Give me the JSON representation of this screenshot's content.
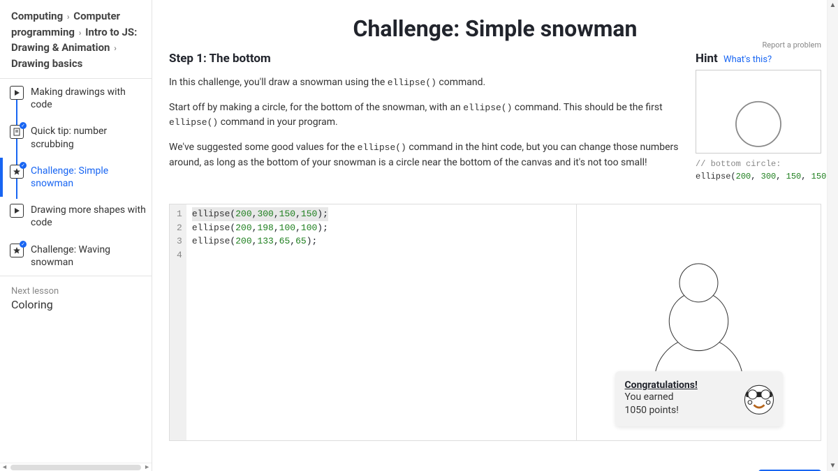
{
  "breadcrumb": [
    "Computing",
    "Computer programming",
    "Intro to JS: Drawing & Animation",
    "Drawing basics"
  ],
  "lessons": [
    {
      "label": "Making drawings with code",
      "icon": "play",
      "badge": false
    },
    {
      "label": "Quick tip: number scrubbing",
      "icon": "doc",
      "badge": true
    },
    {
      "label": "Challenge: Simple snowman",
      "icon": "star",
      "badge": true,
      "current": true
    },
    {
      "label": "Drawing more shapes with code",
      "icon": "play",
      "badge": false
    },
    {
      "label": "Challenge: Waving snowman",
      "icon": "star",
      "badge": true
    }
  ],
  "next_lesson": {
    "label": "Next lesson",
    "title": "Coloring"
  },
  "title": "Challenge: Simple snowman",
  "report_link": "Report a problem",
  "step_heading": "Step 1: The bottom",
  "instructions": {
    "p1_a": "In this challenge, you'll draw a snowman using the ",
    "p1_code": "ellipse()",
    "p1_b": " command.",
    "p2_a": "Start off by making a circle, for the bottom of the snowman, with an ",
    "p2_code": "ellipse()",
    "p2_b": " command. This should be the first ",
    "p2_code2": "ellipse()",
    "p2_c": " command in your program.",
    "p3_a": "We've suggested some good values for the ",
    "p3_code": "ellipse()",
    "p3_b": " command in the hint code, but you can change those numbers around, as long as the bottom of your snowman is a circle near the bottom of the canvas and it's not too small!"
  },
  "hint": {
    "label": "Hint",
    "whats_this": "What's this?",
    "code_comment": "// bottom circle:",
    "code_fn": "ellipse",
    "code_args": [
      "200",
      "300",
      "150",
      "150"
    ]
  },
  "editor": {
    "lines": [
      {
        "n": "1",
        "fn": "ellipse",
        "args": [
          "200",
          "300",
          "150",
          "150"
        ]
      },
      {
        "n": "2",
        "fn": "ellipse",
        "args": [
          "200",
          "198",
          "100",
          "100"
        ]
      },
      {
        "n": "3",
        "fn": "ellipse",
        "args": [
          "200",
          "133",
          "65",
          "65"
        ]
      },
      {
        "n": "4",
        "fn": "",
        "args": []
      }
    ]
  },
  "congrats": {
    "title": "Congratulations!",
    "line1": "You earned",
    "line2": "1050 points!"
  },
  "colors": {
    "accent": "#1865f2"
  }
}
